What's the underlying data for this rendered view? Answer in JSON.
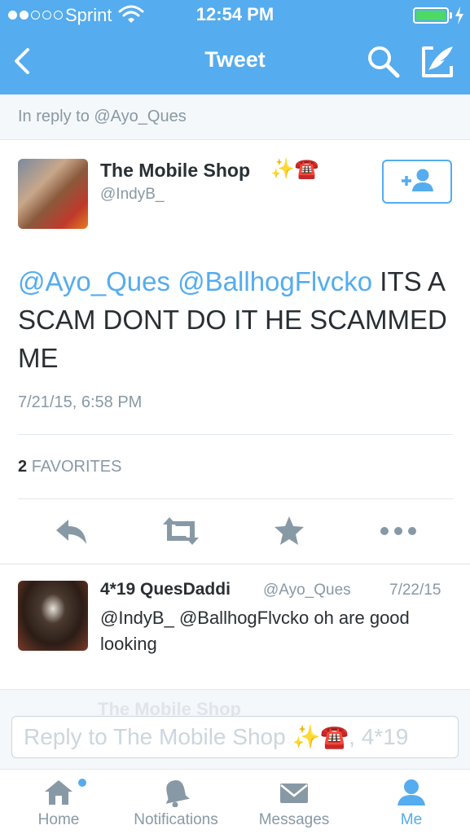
{
  "status_bar": {
    "carrier": "Sprint",
    "time": "12:54 PM",
    "signal_bars_filled": 2,
    "signal_bars_total": 5,
    "battery_level": 1.0,
    "charging": true
  },
  "nav": {
    "title": "Tweet",
    "back_icon": "chevron-left-icon",
    "search_icon": "search-icon",
    "compose_icon": "compose-tweet-icon"
  },
  "reply_context": "In reply to @Ayo_Ques",
  "tweet": {
    "author_name": "The Mobile Shop",
    "author_emoji": "✨☎️",
    "author_handle": "@IndyB_",
    "mention_1": "@Ayo_Ques",
    "mention_2": "@BallhogFlvcko",
    "body": " ITS A SCAM DONT DO IT HE SCAMMED ME",
    "timestamp": "7/21/15, 6:58 PM",
    "favorites_count": "2",
    "favorites_label": "FAVORITES"
  },
  "actions": [
    "reply-icon",
    "retweet-icon",
    "favorite-star-icon",
    "more-icon"
  ],
  "reply": {
    "author_name": "4*19 QuesDaddi",
    "author_handle": "@Ayo_Ques",
    "date": "7/22/15",
    "text": "@IndyB_ @BallhogFlvcko oh are good looking"
  },
  "composer": {
    "ghost_text": "The Mobile Shop",
    "placeholder": "Reply to The Mobile Shop ✨☎️, 4*19"
  },
  "tabs": [
    {
      "label": "Home",
      "icon": "home-icon",
      "active": false
    },
    {
      "label": "Notifications",
      "icon": "bell-icon",
      "active": false
    },
    {
      "label": "Messages",
      "icon": "envelope-icon",
      "active": false
    },
    {
      "label": "Me",
      "icon": "person-icon",
      "active": true
    }
  ],
  "colors": {
    "brand": "#55acee",
    "text": "#292f33",
    "muted": "#8899a6",
    "battery": "#4cd964"
  }
}
